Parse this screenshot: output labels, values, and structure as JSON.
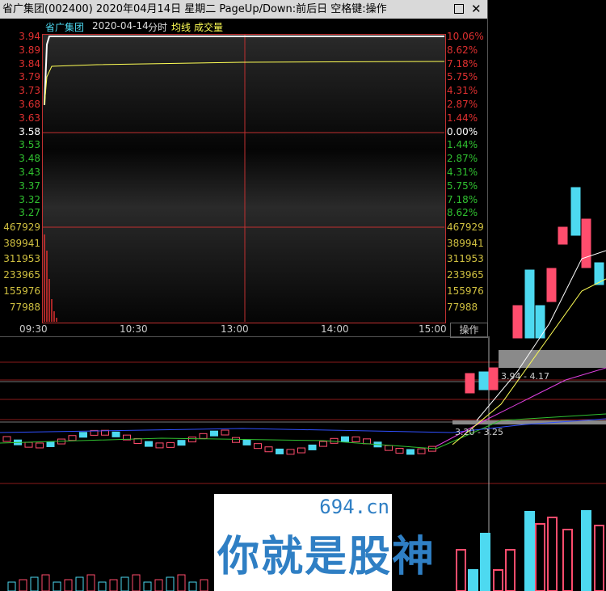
{
  "window": {
    "title": "省广集团(002400) 2020年04月14日 星期二 PageUp/Down:前后日 空格键:操作",
    "max_icon": "maximize-icon",
    "close_icon": "close-icon"
  },
  "info_bar": {
    "stock_name": "省广集团",
    "date": "2020-04-14",
    "mode": "分时",
    "avg_line": "均线",
    "volume": "成交量"
  },
  "price_axis": {
    "left": [
      "3.94",
      "3.89",
      "3.84",
      "3.79",
      "3.73",
      "3.68",
      "3.63",
      "3.58",
      "3.53",
      "3.48",
      "3.43",
      "3.37",
      "3.32",
      "3.27"
    ],
    "right": [
      "10.06%",
      "8.62%",
      "7.18%",
      "5.75%",
      "4.31%",
      "2.87%",
      "1.44%",
      "0.00%",
      "1.44%",
      "2.87%",
      "4.31%",
      "5.75%",
      "7.18%",
      "8.62%"
    ],
    "colors": [
      "#e03030",
      "#e03030",
      "#e03030",
      "#e03030",
      "#e03030",
      "#e03030",
      "#e03030",
      "#ffffff",
      "#30c030",
      "#30c030",
      "#30c030",
      "#30c030",
      "#30c030",
      "#30c030"
    ]
  },
  "volume_axis": {
    "labels": [
      "467929",
      "389941",
      "311953",
      "233965",
      "155976",
      "77988"
    ],
    "color": "#d0c040"
  },
  "time_axis": [
    "09:30",
    "10:30",
    "13:00",
    "14:00",
    "15:00"
  ],
  "action_button": "操作",
  "range_labels": {
    "upper": "3.94 - 4.17",
    "lower": "3.20 - 3.25"
  },
  "watermark": {
    "domain": "694.cn",
    "text": "你就是股神"
  },
  "colors": {
    "up": "#ff4d6d",
    "down": "#4dd9f0",
    "price_line": "#ffffff",
    "avg_line": "#ffff55"
  }
}
